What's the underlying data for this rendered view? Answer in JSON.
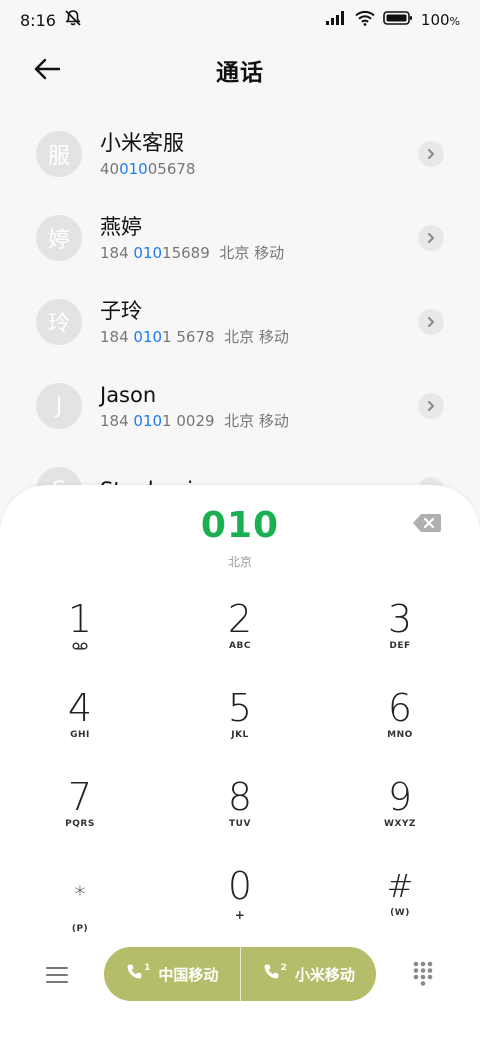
{
  "status": {
    "time": "8:16",
    "battery": "100"
  },
  "header": {
    "title": "通话"
  },
  "contacts": [
    {
      "avatar": "服",
      "name": "小米客服",
      "num_pre": "40",
      "num_hl": "010",
      "num_post": "05678",
      "location": ""
    },
    {
      "avatar": "婷",
      "name": "燕婷",
      "num_pre": "184 ",
      "num_hl": "010",
      "num_post": "15689",
      "location": "北京 移动"
    },
    {
      "avatar": "玲",
      "name": "子玲",
      "num_pre": "184 ",
      "num_hl": "010",
      "num_post": "1 5678",
      "location": "北京 移动"
    },
    {
      "avatar": "J",
      "name": "Jason",
      "num_pre": "184 ",
      "num_hl": "010",
      "num_post": "1 0029",
      "location": "北京 移动"
    },
    {
      "avatar": "S",
      "name": "Stephanie",
      "num_pre": "",
      "num_hl": "",
      "num_post": "",
      "location": ""
    }
  ],
  "dialer": {
    "number": "010",
    "location": "北京",
    "keys": [
      {
        "digit": "1",
        "letters": ""
      },
      {
        "digit": "2",
        "letters": "ABC"
      },
      {
        "digit": "3",
        "letters": "DEF"
      },
      {
        "digit": "4",
        "letters": "GHI"
      },
      {
        "digit": "5",
        "letters": "JKL"
      },
      {
        "digit": "6",
        "letters": "MNO"
      },
      {
        "digit": "7",
        "letters": "PQRS"
      },
      {
        "digit": "8",
        "letters": "TUV"
      },
      {
        "digit": "9",
        "letters": "WXYZ"
      },
      {
        "digit": "*",
        "letters": "(P)"
      },
      {
        "digit": "0",
        "letters": "+"
      },
      {
        "digit": "#",
        "letters": "(W)"
      }
    ]
  },
  "call_buttons": {
    "sim1_label": "中国移动",
    "sim2_label": "小米移动",
    "sim1_index": "1",
    "sim2_index": "2"
  },
  "icons": {
    "back": "arrow-left-icon",
    "mute": "bell-off-icon",
    "signal": "signal-icon",
    "wifi": "wifi-icon",
    "battery": "battery-icon",
    "chevron": "chevron-right-icon",
    "backspace": "backspace-icon",
    "voicemail": "voicemail-icon",
    "menu": "menu-icon",
    "keypad": "keypad-icon"
  },
  "colors": {
    "accent_green": "#1ab052",
    "highlight_blue": "#1e7cf2",
    "call_button": "#b5bd6a"
  }
}
